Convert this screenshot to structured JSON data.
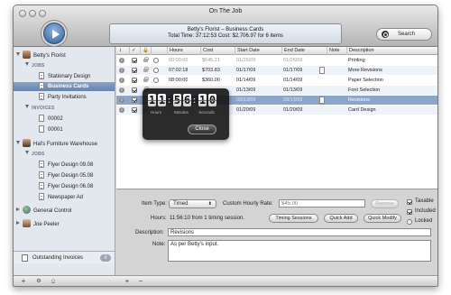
{
  "window": {
    "title": "On The Job"
  },
  "status": {
    "line1": "Betty's Florist – Business Cards",
    "line2": "Total Time: 37:12:53  Cost: $2,706.97 for 6 items"
  },
  "search": {
    "label": "Search"
  },
  "sidebar": {
    "client1": "Betty's Florist",
    "jobs_header": "JOBS",
    "client1_jobs": [
      "Stationary Design",
      "Business Cards",
      "Party Invitations"
    ],
    "invoices_header": "INVOICES",
    "invoices": [
      "00002",
      "00001"
    ],
    "client2": "Hal's Furniture Warehouse",
    "jobs_header2": "JOBS",
    "client2_jobs": [
      "Flyer Design 09.08",
      "Flyer Design 05.08",
      "Flyer Design 06.08",
      "Newspaper Ad"
    ],
    "client3": "General Control",
    "client4": "Joe Peeler",
    "outstanding": "Outstanding Invoices",
    "outstanding_count": "0"
  },
  "bottombar": {
    "add": "+",
    "menu": "⚙",
    "lock": "⎐",
    "add2": "+",
    "remove": "−"
  },
  "table": {
    "headers": [
      "Hours",
      "Cost",
      "Start Date",
      "End Date",
      "Note",
      "Description"
    ],
    "rows": [
      {
        "hours": "00:00:00",
        "cost": "$645.21",
        "start": "01/26/09",
        "end": "01/26/09",
        "desc": "Printing",
        "gray": true,
        "note": false
      },
      {
        "hours": "07:02:18",
        "cost": "$703.83",
        "start": "01/17/09",
        "end": "01/17/09",
        "desc": "More Revisions",
        "gray": false,
        "note": true
      },
      {
        "hours": "08:00:00",
        "cost": "$360.00",
        "start": "01/14/09",
        "end": "01/14/09",
        "desc": "Paper Selection",
        "gray": false,
        "note": false
      },
      {
        "hours": "",
        "cost": "",
        "start": "01/13/09",
        "end": "01/13/09",
        "desc": "Font Selection",
        "gray": false,
        "note": false
      },
      {
        "hours": "",
        "cost": "",
        "start": "03/13/09",
        "end": "03/13/09",
        "desc": "Revisions",
        "gray": true,
        "note": true
      },
      {
        "hours": "",
        "cost": "",
        "start": "01/20/09",
        "end": "01/20/09",
        "desc": "Card Design",
        "gray": false,
        "note": false
      }
    ]
  },
  "timer": {
    "digits": [
      "1",
      "1",
      "5",
      "6",
      "1",
      "0"
    ],
    "units": [
      "Hours",
      "Minutes",
      "Seconds"
    ],
    "close": "Close"
  },
  "editor": {
    "item_type_label": "Item Type:",
    "item_type_value": "Timed",
    "rate_label": "Custom Hourly Rate:",
    "rate_placeholder": "$45.00",
    "remove_label": "Remove",
    "hours_label": "Hours:",
    "hours_value": "11:56:10 from 1 timing session.",
    "timing_sessions": "Timing Sessions",
    "quick_add": "Quick Add",
    "quick_modify": "Quick Modify",
    "description_label": "Description:",
    "description_value": "Revisions",
    "note_label": "Note:",
    "note_value": "As per Betty's input.",
    "taxable": "Taxable",
    "included": "Included",
    "locked": "Locked"
  }
}
